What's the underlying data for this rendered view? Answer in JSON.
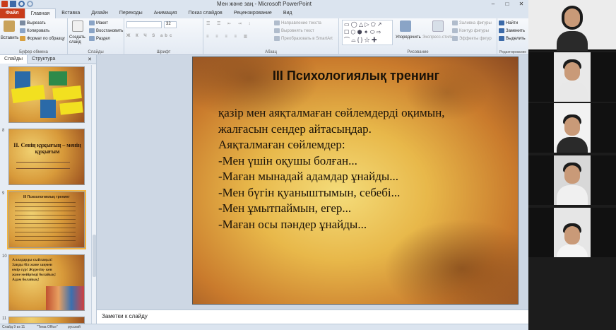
{
  "window": {
    "title": "Мен және заң  -  Microsoft PowerPoint",
    "controls": [
      "–",
      "□",
      "✕"
    ]
  },
  "tabs": [
    "Файл",
    "Главная",
    "Вставка",
    "Дизайн",
    "Переходы",
    "Анимация",
    "Показ слайдов",
    "Рецензирование",
    "Вид"
  ],
  "ribbon": {
    "clipboard": {
      "paste": "Вставить",
      "cut": "Вырезать",
      "copy": "Копировать",
      "format": "Формат по образцу",
      "name": "Буфер обмена"
    },
    "slides": {
      "new": "Создать слайд",
      "layout": "Макет",
      "reset": "Восстановить",
      "section": "Раздел",
      "name": "Слайды"
    },
    "font": {
      "size": "32",
      "name": "Шрифт"
    },
    "paragraph": {
      "direction": "Направление текста",
      "align": "Выровнять текст",
      "smartart": "Преобразовать в SmartArt",
      "name": "Абзац"
    },
    "drawing": {
      "arrange": "Упорядочить",
      "styles": "Экспресс-стили",
      "fill": "Заливка фигуры",
      "outline": "Контур фигуры",
      "effects": "Эффекты фигур",
      "name": "Рисование"
    },
    "editing": {
      "find": "Найти",
      "replace": "Заменить",
      "select": "Выделить",
      "name": "Редактирование"
    }
  },
  "sidebar": {
    "tab_slides": "Слайды",
    "tab_outline": "Структура",
    "close": "✕",
    "items": [
      {
        "num": "7",
        "text": ""
      },
      {
        "num": "8",
        "text": "II. Сенің құқығың – менің құқығым"
      },
      {
        "num": "9",
        "text": "III Психологиялық тренинг"
      },
      {
        "num": "10",
        "text": "Алладарды сыйлаңыз! Заңды біл және заңмен өмір сүр! Жүрегің- кен және мейірімді болайық! Адам болайық!"
      },
      {
        "num": "11",
        "text": ""
      }
    ]
  },
  "slide": {
    "title": "III Психологиялық тренинг",
    "lines": [
      "қазір мен аяқталмаған сөйлемдерді оқимын,",
      "жалғасын сендер айтасыңдар.",
      "Аяқталмаған сөйлемдер:",
      "-Мен үшін оқушы болған...",
      "-Маған мынадай адамдар ұнайды...",
      "-Мен бүгін қуаныштымын, себебі...",
      "-Мен ұмытпаймын, егер...",
      "-Маған осы пәндер ұнайды..."
    ]
  },
  "notes": {
    "placeholder": "Заметки к слайду"
  },
  "status": {
    "slide": "Слайд 9 из 11",
    "theme": "\"Тема Office\"",
    "lang": "русский"
  },
  "colors": {
    "file_tab": "#c93c1b",
    "selection": "#f2b440"
  }
}
